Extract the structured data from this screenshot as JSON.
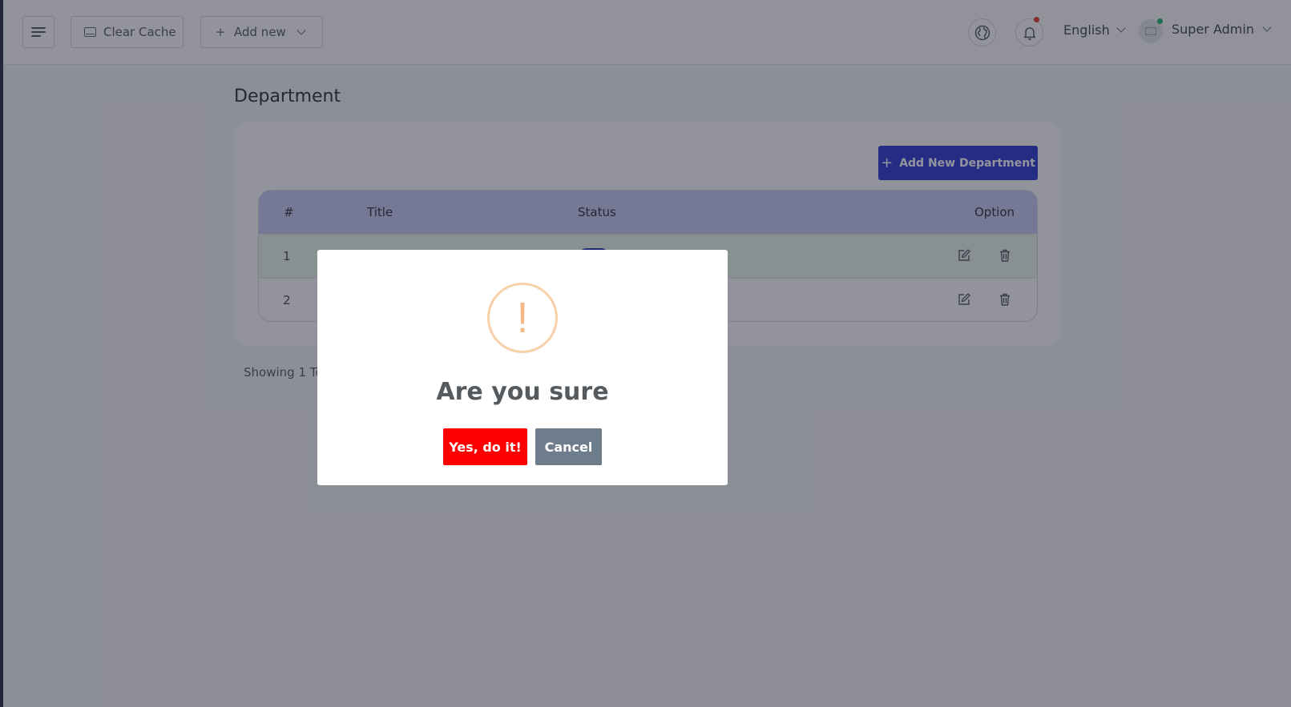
{
  "header": {
    "clear_cache_label": "Clear Cache",
    "add_new_label": "Add new",
    "language": "English",
    "user_name": "Super Admin"
  },
  "page": {
    "title": "Department",
    "add_button_label": "Add New Department",
    "showing_text": "Showing 1 To"
  },
  "table": {
    "columns": [
      "#",
      "Title",
      "Status",
      "Option"
    ],
    "rows": [
      {
        "num": "1"
      },
      {
        "num": "2"
      }
    ]
  },
  "modal": {
    "icon": "!",
    "title": "Are you sure",
    "confirm_label": "Yes, do it!",
    "cancel_label": "Cancel"
  },
  "colors": {
    "accent": "#2b3bd1",
    "confirm": "#ff0000",
    "cancel": "#6e7d8b",
    "warning": "#f8d0a8"
  }
}
